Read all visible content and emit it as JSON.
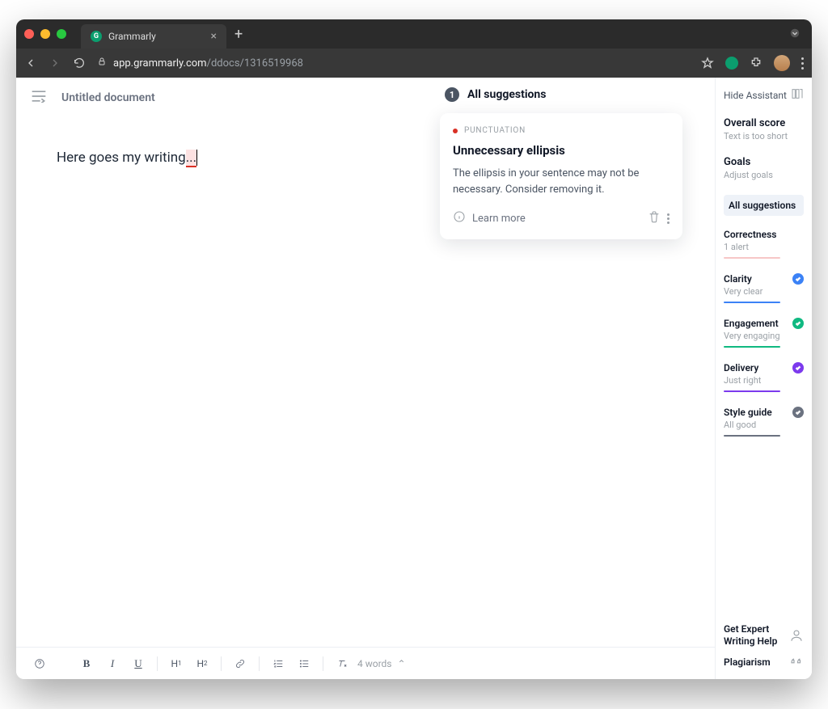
{
  "browser": {
    "tab_title": "Grammarly",
    "url_domain": "app.grammarly.com",
    "url_path": "/ddocs/1316519968"
  },
  "doc": {
    "title": "Untitled document",
    "text_before": "Here goes my writing",
    "text_error": "...",
    "word_count_label": "4 words"
  },
  "suggestions": {
    "header": "All suggestions",
    "count": "1",
    "card": {
      "category": "PUNCTUATION",
      "title": "Unnecessary ellipsis",
      "body": "The ellipsis in your sentence may not be necessary. Consider removing it.",
      "learn_more": "Learn more"
    }
  },
  "sidebar": {
    "hide": "Hide Assistant",
    "overall": {
      "title": "Overall score",
      "sub": "Text is too short"
    },
    "goals": {
      "title": "Goals",
      "sub": "Adjust goals"
    },
    "all_suggestions": "All suggestions",
    "categories": [
      {
        "name": "Correctness",
        "sub": "1 alert",
        "color": "#f7c7c7",
        "check": ""
      },
      {
        "name": "Clarity",
        "sub": "Very clear",
        "color": "#3b82f6",
        "check": "#3b82f6"
      },
      {
        "name": "Engagement",
        "sub": "Very engaging",
        "color": "#10b981",
        "check": "#10b981"
      },
      {
        "name": "Delivery",
        "sub": "Just right",
        "color": "#7c3aed",
        "check": "#7c3aed"
      },
      {
        "name": "Style guide",
        "sub": "All good",
        "color": "#6b7280",
        "check": "#6b7280"
      }
    ],
    "expert": "Get Expert Writing Help",
    "plagiarism": "Plagiarism"
  }
}
